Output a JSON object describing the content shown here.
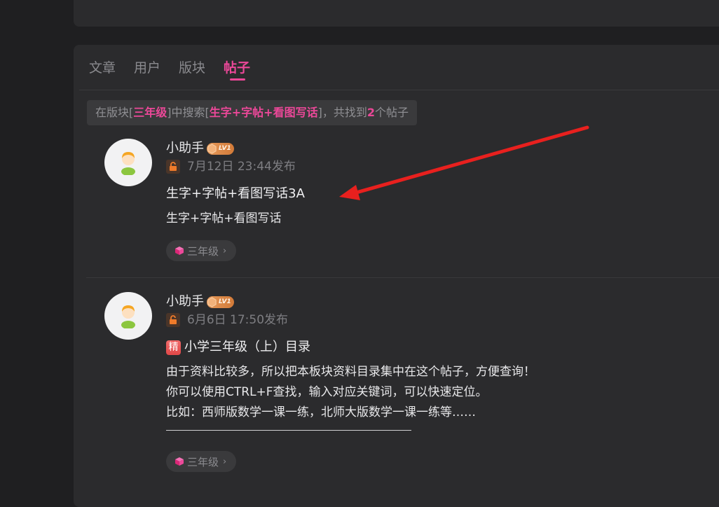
{
  "tabs": [
    {
      "label": "文章"
    },
    {
      "label": "用户"
    },
    {
      "label": "版块"
    },
    {
      "label": "帖子"
    }
  ],
  "search_summary": {
    "prefix": "在版块[",
    "board": "三年级",
    "mid": "]中搜索[",
    "keyword": "生字+字帖+看图写话",
    "suffix": "]，共找到",
    "count": "2",
    "tail": "个帖子"
  },
  "posts": [
    {
      "author": "小助手",
      "level": "LV1",
      "time": "7月12日 23:44发布",
      "title": "生字+字帖+看图写话3A",
      "featured_badge": "",
      "body": "生字+字帖+看图写话",
      "tag": "三年级"
    },
    {
      "author": "小助手",
      "level": "LV1",
      "time": "6月6日 17:50发布",
      "title": "小学三年级（上）目录",
      "featured_badge": "精",
      "body_lines": [
        "由于资料比较多，所以把本板块资料目录集中在这个帖子，方便查询！",
        "你可以使用CTRL+F查找，输入对应关键词，可以快速定位。",
        "比如：西师版数学一课一练，北师大版数学一课一练等……"
      ],
      "tag": "三年级"
    }
  ],
  "colors": {
    "accent": "#ec4899",
    "background": "#1f1f21",
    "card": "#2b2b2d",
    "annotation_arrow": "#e8201e"
  }
}
